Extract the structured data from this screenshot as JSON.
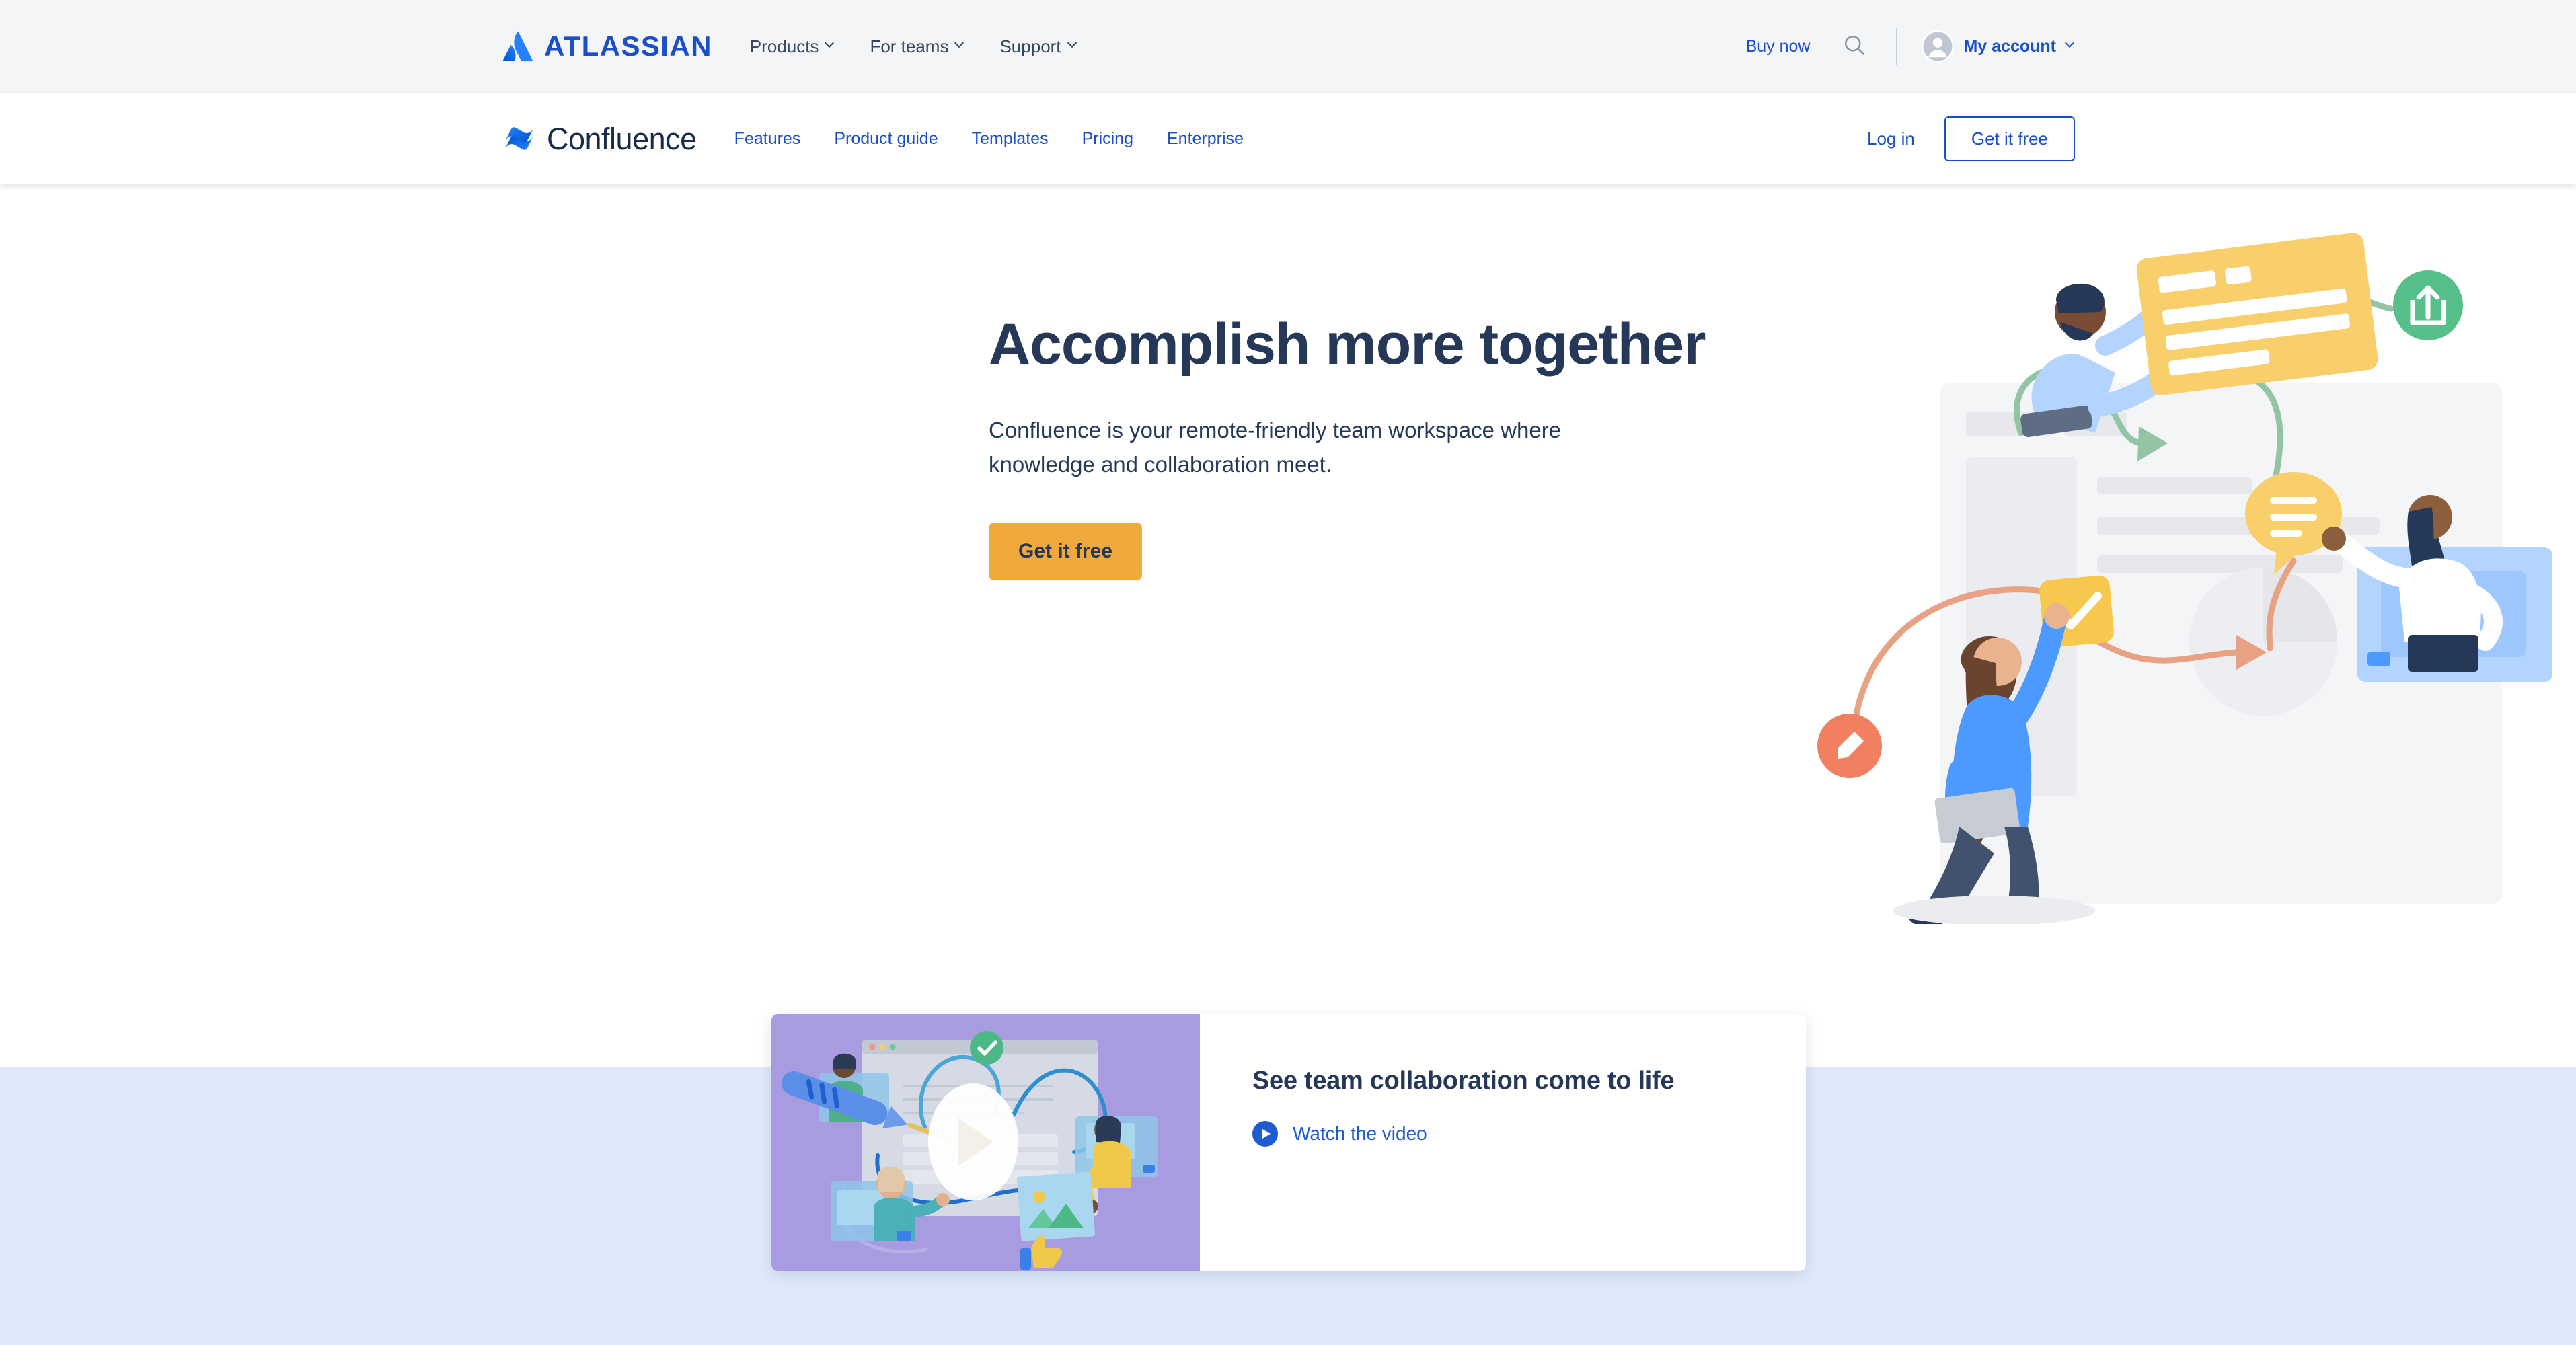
{
  "topbar": {
    "brand": "ATLASSIAN",
    "logo_icon": "atlassian-logo-icon",
    "nav": [
      {
        "label": "Products",
        "icon": "chevron-down-icon"
      },
      {
        "label": "For teams",
        "icon": "chevron-down-icon"
      },
      {
        "label": "Support",
        "icon": "chevron-down-icon"
      }
    ],
    "buy_now": "Buy now",
    "search_icon": "search-icon",
    "avatar_icon": "user-avatar-icon",
    "account_label": "My account",
    "account_caret": "chevron-down-icon",
    "background": "#f4f5f7",
    "link_color": "#1b4ec9"
  },
  "productnav": {
    "logo_icon": "confluence-logo-icon",
    "product_name": "Confluence",
    "links": [
      {
        "label": "Features"
      },
      {
        "label": "Product guide"
      },
      {
        "label": "Templates"
      },
      {
        "label": "Pricing"
      },
      {
        "label": "Enterprise"
      }
    ],
    "login_label": "Log in",
    "cta_label": "Get it free",
    "cta_border_color": "#1b4ec9"
  },
  "hero": {
    "title": "Accomplish more together",
    "subtitle": "Confluence is your remote-friendly team workspace where knowledge and collaboration meet.",
    "cta_label": "Get it free",
    "cta_color": "#f2a93b",
    "cta_text_color": "#253858",
    "illustration_icon": "team-collaboration-illustration"
  },
  "video_card": {
    "thumbnail_icon": "video-thumbnail-illustration",
    "thumbnail_bg": "#a99be0",
    "play_overlay_icon": "play-circle-icon",
    "title": "See team collaboration come to life",
    "link_icon": "play-circle-small-icon",
    "link_label": "Watch the video",
    "link_color": "#1b5bd0"
  },
  "page": {
    "band_color": "#deeafb",
    "background": "#ffffff"
  }
}
